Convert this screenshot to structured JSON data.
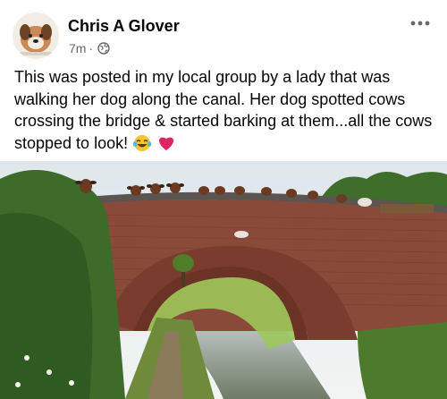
{
  "post": {
    "author": "Chris A Glover",
    "time": "7m",
    "separator": "·",
    "audience_icon": "globe-icon",
    "more_icon": "more-options-icon",
    "text": "This was posted in my local group by a lady that was walking her dog along the canal. Her dog spotted cows crossing the bridge & started barking at them...all the cows stopped to look!",
    "emojis": [
      "laughing-tears-emoji",
      "red-heart-emoji"
    ]
  },
  "photo": {
    "description_icon": "canal-bridge-cows-photo",
    "bridge_plaque": "56"
  },
  "colors": {
    "meta_text": "#65676b",
    "heart": "#e0245e"
  }
}
